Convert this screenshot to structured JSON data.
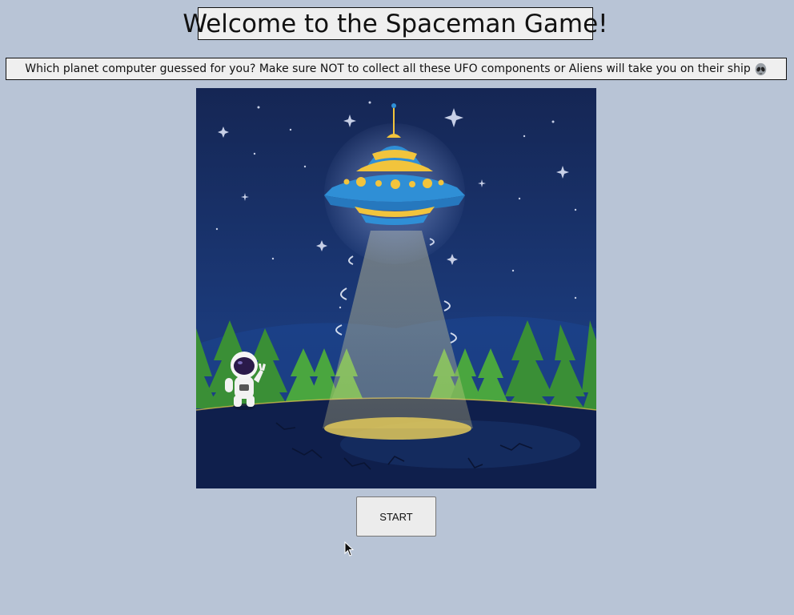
{
  "header": {
    "title": "Welcome to the Spaceman Game!",
    "subtitle": "Which planet computer guessed for you? Make sure NOT to collect all these UFO components or Aliens will take you on their ship"
  },
  "scene": {
    "description_icon": "ufo-abduction-illustration",
    "colors": {
      "sky": "#16285a",
      "ground": "#0f1d48",
      "trees": "#3f9a3a",
      "ufo_blue": "#2f8fd6",
      "ufo_yellow": "#f2c43c",
      "beam": "#d8d3a0"
    }
  },
  "controls": {
    "start_label": "START"
  }
}
